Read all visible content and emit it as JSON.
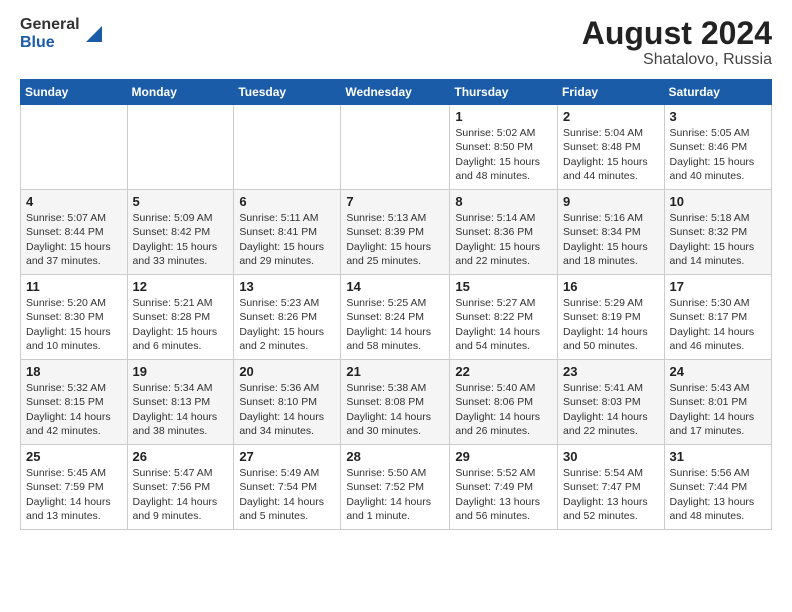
{
  "header": {
    "logo_line1": "General",
    "logo_line2": "Blue",
    "title": "August 2024",
    "subtitle": "Shatalovo, Russia"
  },
  "weekdays": [
    "Sunday",
    "Monday",
    "Tuesday",
    "Wednesday",
    "Thursday",
    "Friday",
    "Saturday"
  ],
  "weeks": [
    [
      {
        "day": "",
        "info": ""
      },
      {
        "day": "",
        "info": ""
      },
      {
        "day": "",
        "info": ""
      },
      {
        "day": "",
        "info": ""
      },
      {
        "day": "1",
        "info": "Sunrise: 5:02 AM\nSunset: 8:50 PM\nDaylight: 15 hours\nand 48 minutes."
      },
      {
        "day": "2",
        "info": "Sunrise: 5:04 AM\nSunset: 8:48 PM\nDaylight: 15 hours\nand 44 minutes."
      },
      {
        "day": "3",
        "info": "Sunrise: 5:05 AM\nSunset: 8:46 PM\nDaylight: 15 hours\nand 40 minutes."
      }
    ],
    [
      {
        "day": "4",
        "info": "Sunrise: 5:07 AM\nSunset: 8:44 PM\nDaylight: 15 hours\nand 37 minutes."
      },
      {
        "day": "5",
        "info": "Sunrise: 5:09 AM\nSunset: 8:42 PM\nDaylight: 15 hours\nand 33 minutes."
      },
      {
        "day": "6",
        "info": "Sunrise: 5:11 AM\nSunset: 8:41 PM\nDaylight: 15 hours\nand 29 minutes."
      },
      {
        "day": "7",
        "info": "Sunrise: 5:13 AM\nSunset: 8:39 PM\nDaylight: 15 hours\nand 25 minutes."
      },
      {
        "day": "8",
        "info": "Sunrise: 5:14 AM\nSunset: 8:36 PM\nDaylight: 15 hours\nand 22 minutes."
      },
      {
        "day": "9",
        "info": "Sunrise: 5:16 AM\nSunset: 8:34 PM\nDaylight: 15 hours\nand 18 minutes."
      },
      {
        "day": "10",
        "info": "Sunrise: 5:18 AM\nSunset: 8:32 PM\nDaylight: 15 hours\nand 14 minutes."
      }
    ],
    [
      {
        "day": "11",
        "info": "Sunrise: 5:20 AM\nSunset: 8:30 PM\nDaylight: 15 hours\nand 10 minutes."
      },
      {
        "day": "12",
        "info": "Sunrise: 5:21 AM\nSunset: 8:28 PM\nDaylight: 15 hours\nand 6 minutes."
      },
      {
        "day": "13",
        "info": "Sunrise: 5:23 AM\nSunset: 8:26 PM\nDaylight: 15 hours\nand 2 minutes."
      },
      {
        "day": "14",
        "info": "Sunrise: 5:25 AM\nSunset: 8:24 PM\nDaylight: 14 hours\nand 58 minutes."
      },
      {
        "day": "15",
        "info": "Sunrise: 5:27 AM\nSunset: 8:22 PM\nDaylight: 14 hours\nand 54 minutes."
      },
      {
        "day": "16",
        "info": "Sunrise: 5:29 AM\nSunset: 8:19 PM\nDaylight: 14 hours\nand 50 minutes."
      },
      {
        "day": "17",
        "info": "Sunrise: 5:30 AM\nSunset: 8:17 PM\nDaylight: 14 hours\nand 46 minutes."
      }
    ],
    [
      {
        "day": "18",
        "info": "Sunrise: 5:32 AM\nSunset: 8:15 PM\nDaylight: 14 hours\nand 42 minutes."
      },
      {
        "day": "19",
        "info": "Sunrise: 5:34 AM\nSunset: 8:13 PM\nDaylight: 14 hours\nand 38 minutes."
      },
      {
        "day": "20",
        "info": "Sunrise: 5:36 AM\nSunset: 8:10 PM\nDaylight: 14 hours\nand 34 minutes."
      },
      {
        "day": "21",
        "info": "Sunrise: 5:38 AM\nSunset: 8:08 PM\nDaylight: 14 hours\nand 30 minutes."
      },
      {
        "day": "22",
        "info": "Sunrise: 5:40 AM\nSunset: 8:06 PM\nDaylight: 14 hours\nand 26 minutes."
      },
      {
        "day": "23",
        "info": "Sunrise: 5:41 AM\nSunset: 8:03 PM\nDaylight: 14 hours\nand 22 minutes."
      },
      {
        "day": "24",
        "info": "Sunrise: 5:43 AM\nSunset: 8:01 PM\nDaylight: 14 hours\nand 17 minutes."
      }
    ],
    [
      {
        "day": "25",
        "info": "Sunrise: 5:45 AM\nSunset: 7:59 PM\nDaylight: 14 hours\nand 13 minutes."
      },
      {
        "day": "26",
        "info": "Sunrise: 5:47 AM\nSunset: 7:56 PM\nDaylight: 14 hours\nand 9 minutes."
      },
      {
        "day": "27",
        "info": "Sunrise: 5:49 AM\nSunset: 7:54 PM\nDaylight: 14 hours\nand 5 minutes."
      },
      {
        "day": "28",
        "info": "Sunrise: 5:50 AM\nSunset: 7:52 PM\nDaylight: 14 hours\nand 1 minute."
      },
      {
        "day": "29",
        "info": "Sunrise: 5:52 AM\nSunset: 7:49 PM\nDaylight: 13 hours\nand 56 minutes."
      },
      {
        "day": "30",
        "info": "Sunrise: 5:54 AM\nSunset: 7:47 PM\nDaylight: 13 hours\nand 52 minutes."
      },
      {
        "day": "31",
        "info": "Sunrise: 5:56 AM\nSunset: 7:44 PM\nDaylight: 13 hours\nand 48 minutes."
      }
    ]
  ]
}
